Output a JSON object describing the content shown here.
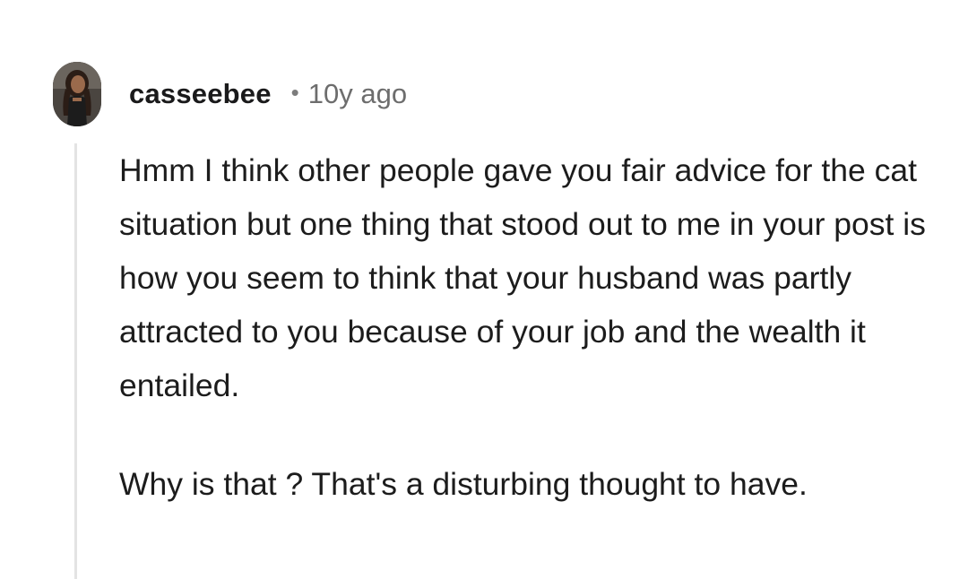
{
  "comment": {
    "author": "casseebee",
    "separator": "•",
    "age": "10y ago",
    "paragraphs": [
      "Hmm I think other people gave you fair advice for the cat situation but one thing that stood out to me in your post is how you seem to think that your husband was partly attracted to you because of your job and the wealth it entailed.",
      "Why is that ? That's a disturbing thought to have."
    ]
  },
  "colors": {
    "username": "#1a1a1b",
    "timestamp": "#6d6d6d",
    "thread_line": "#e3e3e3",
    "body": "#1c1c1c"
  },
  "icons": {
    "avatar": "user-avatar-photo"
  }
}
